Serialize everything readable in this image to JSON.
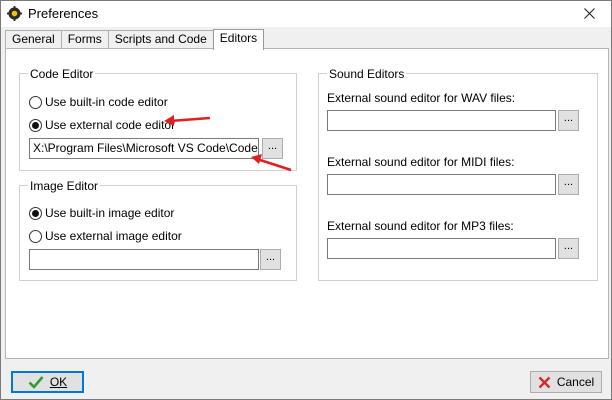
{
  "window": {
    "title": "Preferences"
  },
  "tabs": [
    "General",
    "Forms",
    "Scripts and Code",
    "Editors"
  ],
  "active_tab": "Editors",
  "code_editor": {
    "legend": "Code Editor",
    "option_builtin": "Use built-in code editor",
    "option_external": "Use external code editor",
    "selected": "external",
    "path": "X:\\Program Files\\Microsoft VS Code\\Code.exe",
    "browse_label": "..."
  },
  "image_editor": {
    "legend": "Image Editor",
    "option_builtin": "Use built-in image editor",
    "option_external": "Use external image editor",
    "selected": "builtin",
    "path": "",
    "browse_label": "..."
  },
  "sound_editors": {
    "legend": "Sound Editors",
    "wav_label": "External sound editor for WAV files:",
    "wav_path": "",
    "midi_label": "External sound editor for MIDI files:",
    "midi_path": "",
    "mp3_label": "External sound editor for MP3 files:",
    "mp3_path": "",
    "browse_label": "..."
  },
  "footer": {
    "ok_label": "OK",
    "cancel_label": "Cancel"
  },
  "colors": {
    "annotation_arrow": "#e02020",
    "ok_check": "#2e9e2e",
    "cancel_x": "#d42a2a",
    "default_focus": "#0078d7"
  }
}
